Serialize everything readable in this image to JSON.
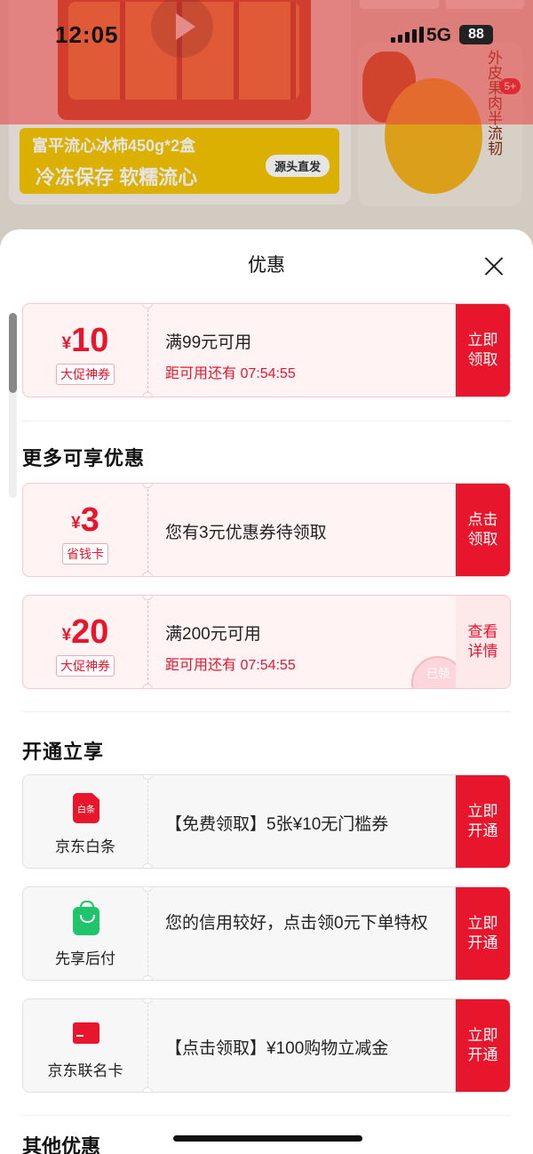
{
  "status_bar": {
    "time": "12:05",
    "network": "5G",
    "battery": "88"
  },
  "background_page": {
    "product_title": "富平流心冰柿450g*2盒",
    "slogan": "冷冻保存 软糯流心",
    "badge": "源头直发",
    "side_text": "外皮果肉半流韧",
    "side_plus": "5+"
  },
  "sheet": {
    "title": "优惠",
    "top_coupon": {
      "currency": "¥",
      "amount": "10",
      "tag": "大促神券",
      "condition": "满99元可用",
      "countdown": "距可用还有 07:54:55",
      "button": "立即领取"
    },
    "more_section_title": "更多可享优惠",
    "saver_card": {
      "currency": "¥",
      "amount": "3",
      "tag": "省钱卡",
      "text": "您有3元优惠券待领取",
      "button": "点击领取"
    },
    "coupon_20": {
      "currency": "¥",
      "amount": "20",
      "tag": "大促神券",
      "condition": "满200元可用",
      "countdown": "距可用还有 07:54:55",
      "button": "查看详情",
      "stamp": "已领"
    },
    "open_section_title": "开通立享",
    "services": [
      {
        "icon": "baitiao-icon",
        "icon_text": "白条",
        "name": "京东白条",
        "text": "【免费领取】5张¥10无门槛券",
        "button": "立即开通"
      },
      {
        "icon": "shopping-bag-icon",
        "name": "先享后付",
        "text": "您的信用较好，点击领0元下单特权",
        "button": "立即开通"
      },
      {
        "icon": "credit-card-icon",
        "name": "京东联名卡",
        "text": "【点击领取】¥100购物立减金",
        "button": "立即开通"
      }
    ],
    "other_section_title": "其他优惠"
  },
  "colors": {
    "accent": "#e8162c",
    "card_bg": "#fff3f4"
  }
}
